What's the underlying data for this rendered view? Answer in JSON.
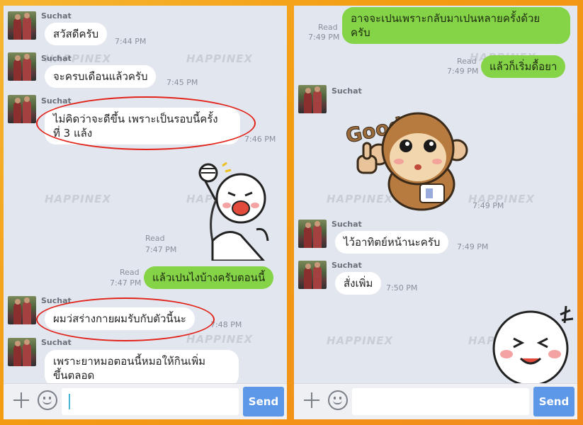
{
  "watermark": "HAPPINEX",
  "left_panel": {
    "messages": [
      {
        "sender": "Suchat",
        "text": "สวัสดีครับ",
        "time": "7:44 PM"
      },
      {
        "sender": "Suchat",
        "text": "จะครบเดือนแล้วครับ",
        "time": "7:45 PM"
      },
      {
        "sender": "Suchat",
        "text_line1": "ไม่คิดว่าจะดีขึ้น เพราะเป็นรอบนี้ครั้ง",
        "text_line2": "ที่ 3 แล้ง",
        "time": "7:46 PM"
      },
      {
        "status": "Read",
        "time": "7:47 PM"
      },
      {
        "status": "Read",
        "time": "7:47 PM",
        "text": "แล้วเปนไงบ้างครับตอนนี้"
      },
      {
        "sender": "Suchat",
        "text": "ผมว่สร่างกายผมรับกับตัวนี้นะ",
        "time": "7:48 PM"
      },
      {
        "sender": "Suchat",
        "text_line1": "เพราะยาหมอตอนนี้หมอให้กินเพิ่ม",
        "text_line2": "ขึ้นตลอด"
      }
    ]
  },
  "right_panel": {
    "messages": [
      {
        "status": "Read",
        "time": "7:49 PM",
        "text_line1": "อาจจะเปนเพราะกลับมาเปนหลายครั้งด้วย",
        "text_line2": "ครับ"
      },
      {
        "status": "Read",
        "time": "7:49 PM",
        "text": "แล้วก็เริ่มดื้อยา"
      },
      {
        "sender": "Suchat",
        "sticker_text": "Good",
        "time": "7:49 PM"
      },
      {
        "sender": "Suchat",
        "text": "ไว้อาทิตย์หน้านะครับ",
        "time": "7:49 PM"
      },
      {
        "sender": "Suchat",
        "text": "สั่งเพิ่ม",
        "time": "7:50 PM"
      }
    ]
  },
  "input_bar": {
    "send_label": "Send",
    "icons": [
      "plus-icon",
      "emoji-icon"
    ]
  },
  "colors": {
    "outgoing_bubble": "#85d347",
    "incoming_bubble": "#ffffff",
    "chat_background": "#e2e6ee",
    "send_button": "#5c97e8",
    "highlight_ring": "#e2231a"
  }
}
